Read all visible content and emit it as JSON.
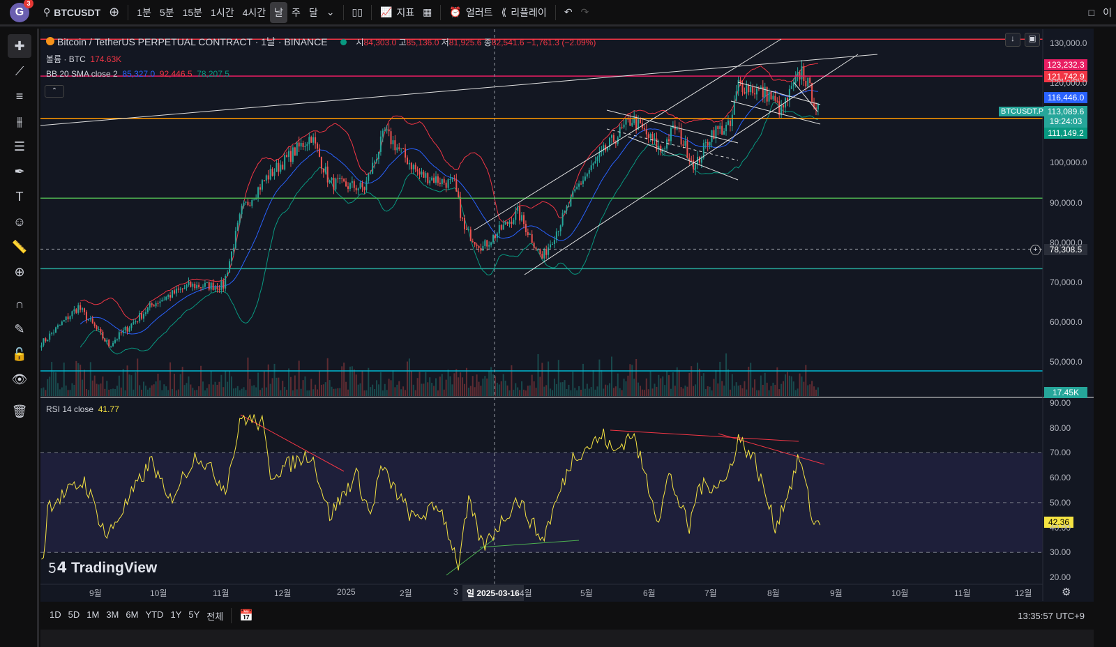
{
  "topbar": {
    "avatar": "G",
    "notif": "3",
    "symbol": "BTCUSDT",
    "intervals": [
      "1분",
      "5분",
      "15분",
      "1시간",
      "4시간",
      "날",
      "주",
      "달"
    ],
    "active_interval": "날",
    "indicators": "지표",
    "alert": "얼러트",
    "replay": "리플레이",
    "right_label": "이"
  },
  "legend": {
    "title": "Bitcoin / TetherUS PERPETUAL CONTRACT · 1날 · BINANCE",
    "o_label": "시",
    "o": "84,303.0",
    "h_label": "고",
    "h": "85,136.0",
    "l_label": "저",
    "l": "81,925.6",
    "c_label": "종",
    "c": "82,541.6",
    "chg": "−1,761.3 (−2.09%)",
    "volume_label": "볼륨 · BTC",
    "volume": "174.63K",
    "bb_label": "BB 20 SMA close 2",
    "bb_basis": "85,327.0",
    "bb_upper": "92,446.5",
    "bb_lower": "78,207.5",
    "rsi_label": "RSI 14 close",
    "rsi": "41.77"
  },
  "price_axis": {
    "ticks": [
      "130,000.0",
      "120,000.0",
      "100,000.0",
      "90,000.0",
      "80,000.0",
      "70,000.0",
      "60,000.0",
      "50,000.0"
    ],
    "tags": {
      "upper": "123,232.3",
      "level": "121,742.9",
      "basis": "116,446.0",
      "symbol": "BTCUSDT.P",
      "last": "113,089.6",
      "countdown": "19:24:03",
      "lower": "111,149.2",
      "crosshair": "78,308.5",
      "volume": "17.45K"
    }
  },
  "rsi_axis": {
    "ticks": [
      "90.00",
      "80.00",
      "70.00",
      "60.00",
      "50.00",
      "40.00",
      "30.00",
      "20.00"
    ],
    "value": "42.36"
  },
  "time_axis": {
    "labels": [
      "9월",
      "10월",
      "11월",
      "12월",
      "2025",
      "2월",
      "3",
      "4월",
      "5월",
      "6월",
      "7월",
      "8월",
      "9월",
      "10월",
      "11월",
      "12월"
    ],
    "crosshair": "일 2025-03-16"
  },
  "bottombar": {
    "ranges": [
      "1D",
      "5D",
      "1M",
      "3M",
      "6M",
      "YTD",
      "1Y",
      "5Y",
      "전체"
    ],
    "clock": "13:35:57 UTC+9"
  },
  "watermark": "TradingView",
  "colors": {
    "up": "#26a69a",
    "down": "#ef5350",
    "bb_basis": "#2962ff",
    "bb_upper": "#f23645",
    "bb_lower": "#089981",
    "rsi": "#f5e342"
  },
  "chart_data": {
    "type": "candlestick",
    "price_anchors": [
      [
        "2024-08-05",
        55100
      ],
      [
        "2024-08-22",
        63800
      ],
      [
        "2024-09-06",
        54200
      ],
      [
        "2024-09-28",
        64700
      ],
      [
        "2024-10-15",
        69100
      ],
      [
        "2024-11-01",
        69100
      ],
      [
        "2024-11-10",
        88000
      ],
      [
        "2024-11-22",
        96200
      ],
      [
        "2024-12-14",
        106700
      ],
      [
        "2024-12-23",
        95000
      ],
      [
        "2025-01-09",
        93600
      ],
      [
        "2025-01-19",
        107600
      ],
      [
        "2025-02-05",
        97000
      ],
      [
        "2025-02-22",
        94500
      ],
      [
        "2025-02-27",
        83000
      ],
      [
        "2025-03-08",
        78800
      ],
      [
        "2025-03-25",
        87500
      ],
      [
        "2025-04-06",
        76000
      ],
      [
        "2025-04-14",
        84000
      ],
      [
        "2025-04-24",
        94500
      ],
      [
        "2025-05-08",
        104000
      ],
      [
        "2025-05-20",
        111000
      ],
      [
        "2025-06-03",
        103000
      ],
      [
        "2025-06-10",
        109000
      ],
      [
        "2025-06-20",
        99000
      ],
      [
        "2025-06-28",
        107700
      ],
      [
        "2025-07-07",
        109000
      ],
      [
        "2025-07-11",
        119800
      ],
      [
        "2025-07-26",
        117000
      ],
      [
        "2025-08-01",
        112800
      ],
      [
        "2025-08-11",
        123300
      ],
      [
        "2025-08-19",
        113000
      ]
    ],
    "rsi_anchors": [
      [
        "2024-08-05",
        27.8
      ],
      [
        "2024-08-07",
        48.8
      ],
      [
        "2024-08-25",
        58.6
      ],
      [
        "2024-09-05",
        36.2
      ],
      [
        "2024-09-27",
        67
      ],
      [
        "2024-10-05",
        50
      ],
      [
        "2024-10-19",
        69.8
      ],
      [
        "2024-11-02",
        55.8
      ],
      [
        "2024-11-10",
        84.4
      ],
      [
        "2024-11-20",
        81.6
      ],
      [
        "2024-11-24",
        61.4
      ],
      [
        "2024-12-14",
        69.8
      ],
      [
        "2024-12-23",
        44.6
      ],
      [
        "2025-01-05",
        61.4
      ],
      [
        "2025-01-12",
        44.6
      ],
      [
        "2025-01-17",
        64.2
      ],
      [
        "2025-02-02",
        43.2
      ],
      [
        "2025-02-15",
        48.8
      ],
      [
        "2025-02-24",
        25
      ],
      [
        "2025-03-01",
        50
      ],
      [
        "2025-03-08",
        32
      ],
      [
        "2025-03-25",
        51.6
      ],
      [
        "2025-04-06",
        34.8
      ],
      [
        "2025-04-21",
        68.4
      ],
      [
        "2025-05-06",
        76.8
      ],
      [
        "2025-05-11",
        69.8
      ],
      [
        "2025-05-20",
        78.2
      ],
      [
        "2025-06-02",
        43.2
      ],
      [
        "2025-06-07",
        61.4
      ],
      [
        "2025-06-17",
        39
      ],
      [
        "2025-06-21",
        55.8
      ],
      [
        "2025-07-05",
        58.6
      ],
      [
        "2025-07-11",
        76
      ],
      [
        "2025-07-19",
        67
      ],
      [
        "2025-07-29",
        40.4
      ],
      [
        "2025-08-05",
        55.8
      ],
      [
        "2025-08-10",
        68.4
      ],
      [
        "2025-08-17",
        40.4
      ],
      [
        "2025-08-18",
        42.4
      ]
    ],
    "horizontal_levels": [
      131000,
      121742.9,
      111149.2,
      91100,
      78308.5,
      73400
    ],
    "price_range": [
      50000,
      130000
    ],
    "rsi_range": [
      20,
      90
    ],
    "rsi_bands": [
      30,
      50,
      70
    ],
    "x_range": [
      "2024-08-04",
      "2025-12-25"
    ]
  }
}
